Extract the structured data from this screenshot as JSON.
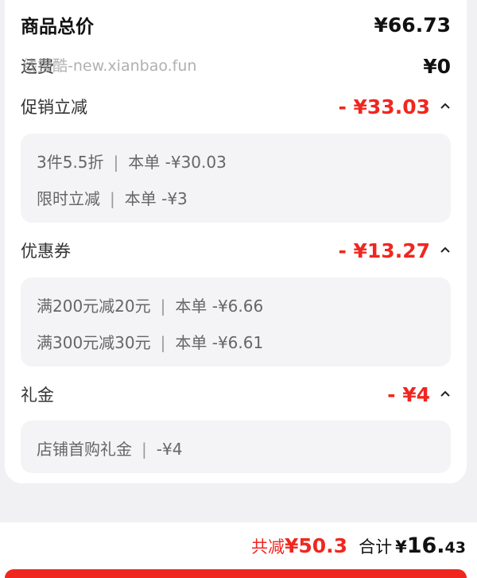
{
  "summary": {
    "goods_total_label": "商品总价",
    "goods_total_value": "¥66.73",
    "shipping_label": "运费",
    "shipping_value": "¥0",
    "watermark": "线报酷-new.xianbao.fun"
  },
  "promotion": {
    "label": "促销立减",
    "value": "- ¥33.03",
    "items": [
      {
        "name": "3件5.5折",
        "sep": "|",
        "detail": "本单 -¥30.03"
      },
      {
        "name": "限时立减",
        "sep": "|",
        "detail": "本单 -¥3"
      }
    ]
  },
  "coupon": {
    "label": "优惠券",
    "value": "- ¥13.27",
    "items": [
      {
        "name": "满200元减20元",
        "sep": "|",
        "detail": "本单 -¥6.66"
      },
      {
        "name": "满300元减30元",
        "sep": "|",
        "detail": "本单 -¥6.61"
      }
    ]
  },
  "gift_money": {
    "label": "礼金",
    "value": "- ¥4",
    "items": [
      {
        "name": "店铺首购礼金",
        "sep": "|",
        "detail": "-¥4"
      }
    ]
  },
  "bottom": {
    "discount_label": "共减",
    "discount_value": "¥50.3",
    "total_label": "合计",
    "total_currency": "¥",
    "total_integer": "16.",
    "total_decimal": "43"
  },
  "icons": {
    "collapse": "chevron-up-icon"
  },
  "colors": {
    "accent_red": "#f0271f",
    "card_bg": "#ffffff",
    "page_bg": "#f1f1f3",
    "sub_box_bg": "#f4f4f6"
  }
}
